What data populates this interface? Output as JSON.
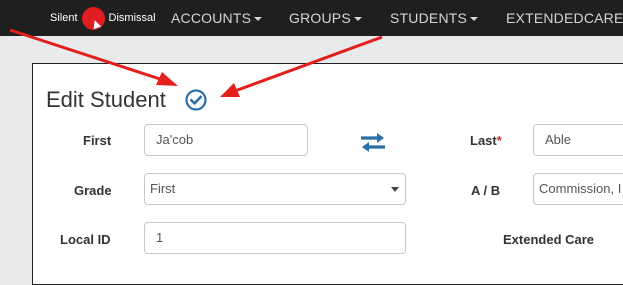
{
  "navbar": {
    "brand_left": "Silent",
    "brand_right": "Dismissal",
    "items": [
      {
        "label": "ACCOUNTS"
      },
      {
        "label": "GROUPS"
      },
      {
        "label": "STUDENTS"
      },
      {
        "label": "EXTENDEDCARE"
      }
    ]
  },
  "form": {
    "title": "Edit Student",
    "first": {
      "label": "First",
      "value": "Ja'cob"
    },
    "last": {
      "label": "Last",
      "required_mark": "*",
      "value": "Able"
    },
    "grade": {
      "label": "Grade",
      "value": "First"
    },
    "ab": {
      "label": "A / B",
      "value": "Commission, I"
    },
    "local_id": {
      "label": "Local ID",
      "value": "1"
    },
    "extended_care": {
      "label": "Extended Care"
    }
  },
  "colors": {
    "navbar_bg": "#1f1f1f",
    "brand_red": "#e01e22",
    "accent_blue": "#2a6fa8",
    "annotation_red": "#e3201b"
  },
  "icons": {
    "verified": "check-circle-icon",
    "swap": "swap-arrows-icon"
  }
}
